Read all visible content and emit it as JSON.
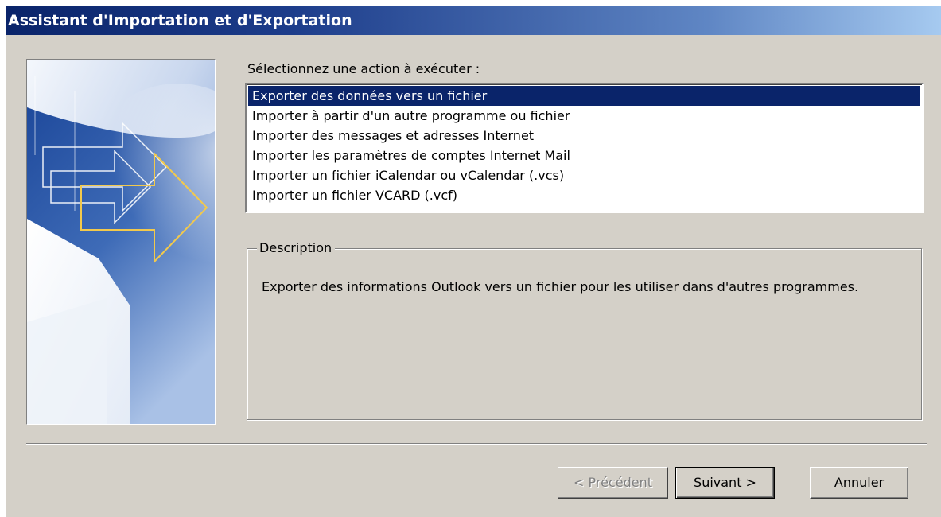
{
  "window": {
    "title": "Assistant d'Importation et d'Exportation"
  },
  "prompt": "Sélectionnez une action à exécuter :",
  "actions": {
    "selected_index": 0,
    "items": [
      "Exporter des données vers un fichier",
      "Importer à partir d'un autre programme ou fichier",
      "Importer des messages et adresses Internet",
      "Importer les paramètres de comptes Internet Mail",
      "Importer un fichier iCalendar ou vCalendar (.vcs)",
      "Importer un fichier VCARD (.vcf)"
    ]
  },
  "description": {
    "legend": "Description",
    "text": "Exporter des informations Outlook vers un fichier pour les utiliser dans d'autres programmes."
  },
  "buttons": {
    "previous": "< Précédent",
    "next": "Suivant >",
    "cancel": "Annuler"
  },
  "colors": {
    "titlebar_start": "#0a246a",
    "titlebar_end": "#a6caf0",
    "dialog_face": "#d4d0c8",
    "selection": "#0a246a",
    "banner_arrow_outline": "#f2c94c"
  },
  "icons": {
    "banner": "import-export-arrows-graphic"
  }
}
